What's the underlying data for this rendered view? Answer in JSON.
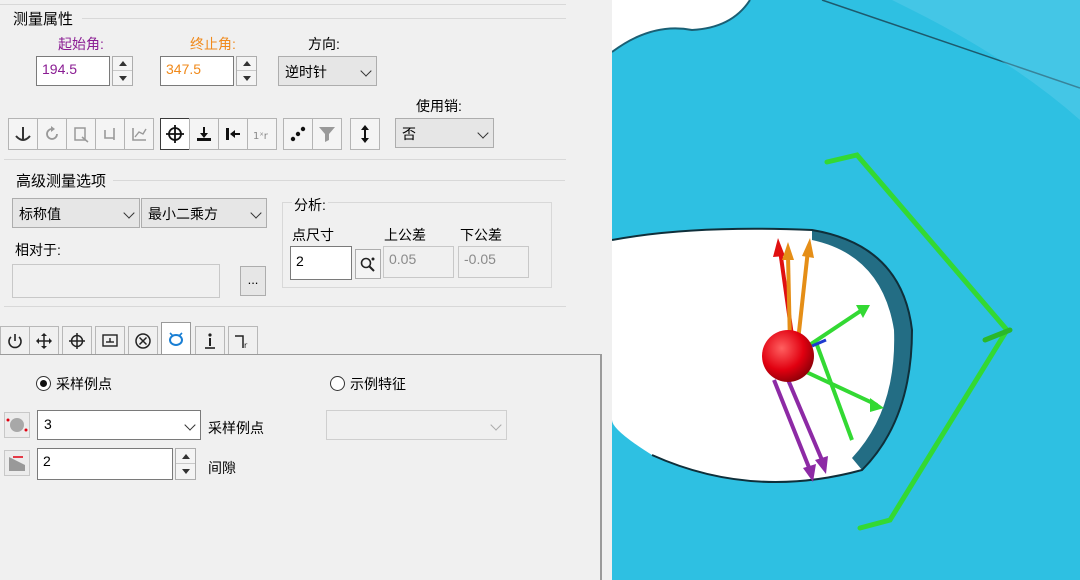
{
  "measure_props": {
    "title": "测量属性",
    "start_angle_label": "起始角:",
    "start_angle_value": "194.5",
    "end_angle_label": "终止角:",
    "end_angle_value": "347.5",
    "direction_label": "方向:",
    "direction_value": "逆时针",
    "use_pin_label": "使用销:",
    "use_pin_value": "否"
  },
  "advanced": {
    "title": "高级测量选项",
    "nominal_value": "标称值",
    "fit_method": "最小二乘方",
    "relative_to_label": "相对于:",
    "relative_to_value": "",
    "browse_label": "...",
    "analysis_title": "分析:",
    "point_size_label": "点尺寸",
    "point_size_value": "2",
    "upper_tol_label": "上公差",
    "upper_tol_value": "0.05",
    "lower_tol_label": "下公差",
    "lower_tol_value": "-0.05"
  },
  "sampling": {
    "radio_sample_points": "采样例点",
    "radio_sample_feature": "示例特征",
    "points_value": "3",
    "points_label": "采样例点",
    "gap_value": "2",
    "gap_label": "间隙",
    "feature_value": ""
  },
  "colors": {
    "start_angle": "#8a1c93",
    "end_angle": "#f0891a",
    "viewport_bg": "#2ec0e2",
    "hole_fill": "#ffffff",
    "probe_ball": "#e10010",
    "vector_green": "#2ee12e",
    "vector_orange": "#e58e17",
    "vector_purple": "#8d2aa5"
  },
  "icons": {
    "toolbar": [
      "anchor-icon",
      "rotate-icon",
      "fit-plane-icon",
      "return-icon",
      "plot-icon",
      "crosshair-icon",
      "project-down-icon",
      "move-left-icon",
      "scale-icon",
      "scatter-icon",
      "filter-icon",
      "vertical-measure-icon"
    ],
    "tabs": [
      "power-icon",
      "move-icon",
      "target-icon",
      "image-icon",
      "close-circle-icon",
      "ring-icon",
      "info-icon",
      "tolerance-icon"
    ]
  }
}
